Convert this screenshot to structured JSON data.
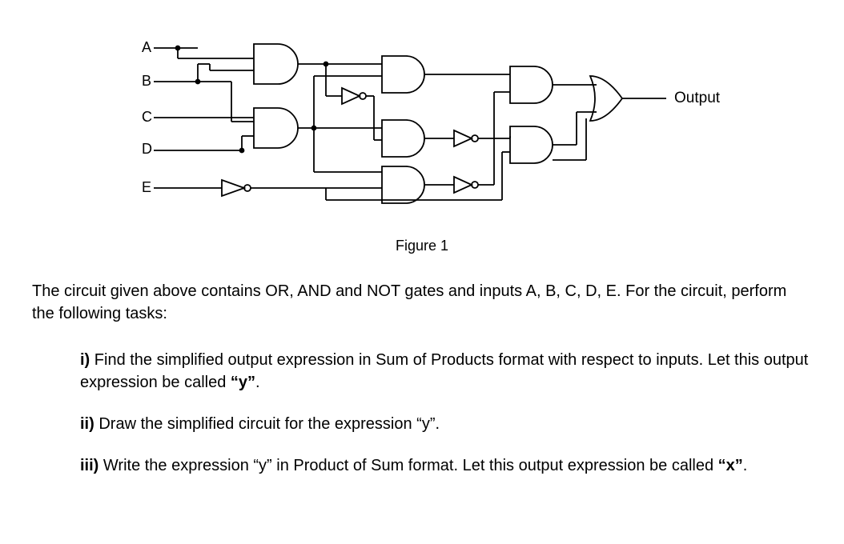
{
  "figure_caption": "Figure 1",
  "inputs": {
    "A": "A",
    "B": "B",
    "C": "C",
    "D": "D",
    "E": "E"
  },
  "output_label": "Output",
  "intro": "The circuit given above contains OR, AND and NOT gates and inputs A, B, C, D, E. For the circuit, perform the following tasks:",
  "tasks": {
    "i_prefix": "i) ",
    "i_text_a": "Find the simplified output expression in Sum of Products format with respect to inputs. Let this output expression be called ",
    "i_quote": "“y”",
    "i_tail": ".",
    "ii_prefix": "ii) ",
    "ii_text": "Draw the simplified circuit for the expression “y”.",
    "iii_prefix": "iii) ",
    "iii_text_a": "Write the expression “y” in Product of Sum format. Let this output expression be called ",
    "iii_quote": "“x”",
    "iii_tail": "."
  }
}
